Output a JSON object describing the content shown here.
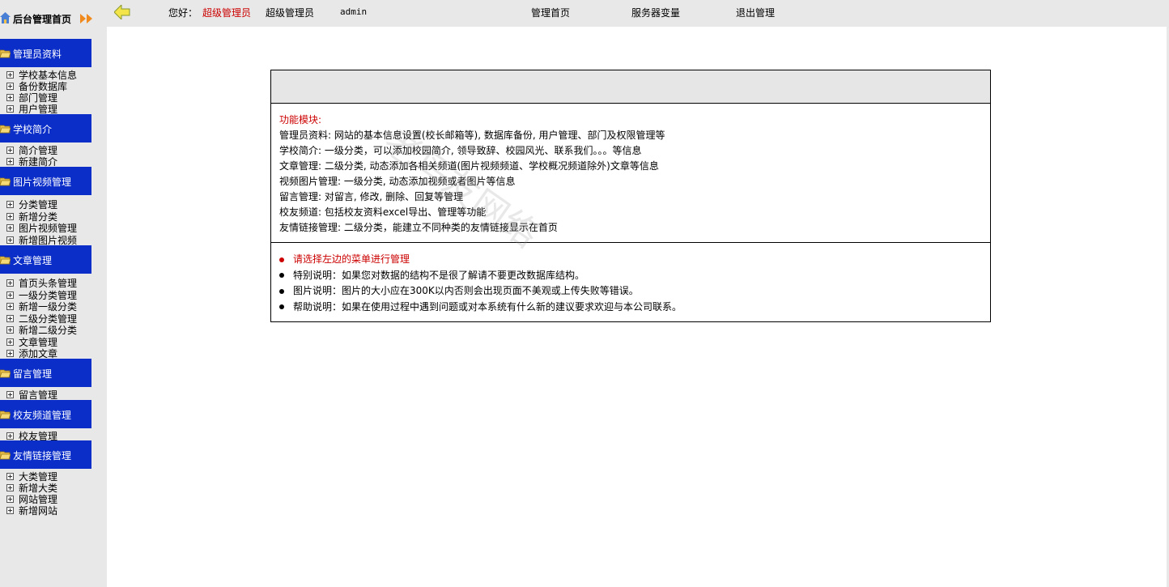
{
  "brand": {
    "title": "后台管理首页"
  },
  "sidebar": {
    "sections": [
      {
        "label": "管理员资料",
        "items": [
          "学校基本信息",
          "备份数据库",
          "部门管理",
          "用户管理"
        ]
      },
      {
        "label": "学校简介",
        "items": [
          "简介管理",
          "新建简介"
        ]
      },
      {
        "label": "图片视频管理",
        "items": [
          "分类管理",
          "新增分类",
          "图片视频管理",
          "新增图片视频"
        ]
      },
      {
        "label": "文章管理",
        "items": [
          "首页头条管理",
          "一级分类管理",
          "新增一级分类",
          "二级分类管理",
          "新增二级分类",
          "文章管理",
          "添加文章"
        ]
      },
      {
        "label": "留言管理",
        "items": [
          "留言管理"
        ]
      },
      {
        "label": "校友频道管理",
        "items": [
          "校友管理"
        ]
      },
      {
        "label": "友情链接管理",
        "items": [
          "大类管理",
          "新增大类",
          "网站管理",
          "新增网站"
        ]
      }
    ]
  },
  "topbar": {
    "greeting": "您好：",
    "role": "超级管理员",
    "username": "超级管理员",
    "account": "admin",
    "nav": [
      "管理首页",
      "服务器变量",
      "退出管理"
    ]
  },
  "main": {
    "modules_title": "功能模块:",
    "modules": [
      "管理员资料: 网站的基本信息设置(校长邮箱等), 数据库备份, 用户管理、部门及权限管理等",
      "学校简介: 一级分类，可以添加校园简介, 领导致辞、校园风光、联系我们。。。等信息",
      "文章管理: 二级分类, 动态添加各相关频道(图片视频频道、学校概况频道除外)文章等信息",
      "视频图片管理: 一级分类, 动态添加视频或者图片等信息",
      "留言管理: 对留言, 修改, 删除、回复等管理",
      "校友频道: 包括校友资料excel导出、管理等功能",
      "友情链接管理: 二级分类，能建立不同种类的友情链接显示在首页"
    ],
    "notes": [
      "请选择左边的菜单进行管理",
      "特别说明：如果您对数据的结构不是很了解请不要更改数据库结构。",
      "图片说明：图片的大小应在300K以内否则会出现页面不美观或上传失败等错误。",
      "帮助说明：如果在使用过程中遇到问题或对本系统有什么新的建议要求欢迎与本公司联系。"
    ],
    "watermark": "老鸟友网络"
  },
  "colors": {
    "section_bg": "#0b2ec9",
    "accent_red": "#cc0000",
    "panel_bg": "#e8e8e8"
  }
}
